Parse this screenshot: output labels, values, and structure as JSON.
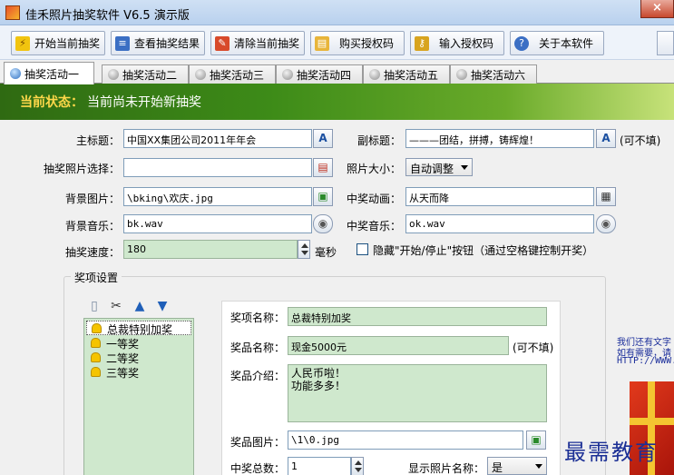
{
  "window": {
    "title": "佳禾照片抽奖软件 V6.5 演示版",
    "close_label": "×"
  },
  "toolbar": {
    "buttons": [
      {
        "label": "开始当前抽奖",
        "icon": "lightning-icon"
      },
      {
        "label": "查看抽奖结果",
        "icon": "results-list-icon"
      },
      {
        "label": "清除当前抽奖",
        "icon": "eraser-icon"
      },
      {
        "label": "购买授权码",
        "icon": "document-cart-icon"
      },
      {
        "label": "输入授权码",
        "icon": "key-icon"
      },
      {
        "label": "关于本软件",
        "icon": "help-icon"
      }
    ]
  },
  "tabs": [
    {
      "label": "抽奖活动一",
      "active": true
    },
    {
      "label": "抽奖活动二",
      "active": false
    },
    {
      "label": "抽奖活动三",
      "active": false
    },
    {
      "label": "抽奖活动四",
      "active": false
    },
    {
      "label": "抽奖活动五",
      "active": false
    },
    {
      "label": "抽奖活动六",
      "active": false
    }
  ],
  "status": {
    "label": "当前状态：",
    "text": "当前尚未开始新抽奖"
  },
  "form": {
    "main_title_label": "主标题：",
    "main_title_value": "中国XX集团公司2011年年会",
    "subtitle_label": "副标题：",
    "subtitle_value": "———团结，拼搏，铸辉煌！",
    "subtitle_note": "(可不填)",
    "photo_select_label": "抽奖照片选择：",
    "photo_select_value": "",
    "photo_size_label": "照片大小：",
    "photo_size_value": "自动调整",
    "bg_image_label": "背景图片：",
    "bg_image_value": "\\bking\\欢庆.jpg",
    "win_anim_label": "中奖动画：",
    "win_anim_value": "从天而降",
    "bg_music_label": "背景音乐：",
    "bg_music_value": "bk.wav",
    "win_music_label": "中奖音乐：",
    "win_music_value": "ok.wav",
    "speed_label": "抽奖速度：",
    "speed_value": "180",
    "speed_unit": "毫秒",
    "hide_buttons_label": "隐藏\"开始/停止\"按钮（通过空格键控制开奖）",
    "hide_buttons_checked": false,
    "font_button_label": "A"
  },
  "prizes": {
    "group_title": "奖项设置",
    "items": [
      "总裁特别加奖",
      "一等奖",
      "二等奖",
      "三等奖"
    ],
    "selected_index": 0,
    "prize_name_label": "奖项名称：",
    "prize_name_value": "总裁特别加奖",
    "item_name_label": "奖品名称：",
    "item_name_value": "现金5000元",
    "item_name_note": "(可不填)",
    "item_desc_label": "奖品介绍：",
    "item_desc_value": "人民币啦！\n功能多多！",
    "item_image_label": "奖品图片：",
    "item_image_value": "\\1\\0.jpg",
    "total_label": "中奖总数：",
    "total_value": "1",
    "show_name_label": "显示照片名称：",
    "show_name_value": "是"
  },
  "side": {
    "line1": "我们还有文字",
    "line2": "如有需要，请",
    "line3": "HTTP://WWW."
  },
  "watermark": "最需教育"
}
